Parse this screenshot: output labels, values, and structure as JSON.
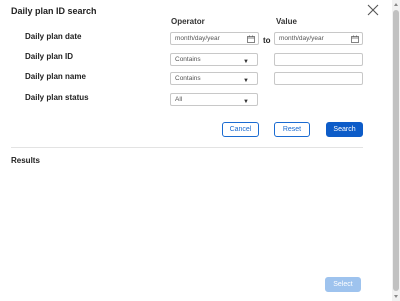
{
  "dialog": {
    "title": "Daily plan ID search",
    "close_icon": "close-icon"
  },
  "columns": {
    "operator": "Operator",
    "value": "Value"
  },
  "rows": {
    "date": {
      "label": "Daily plan date",
      "from_placeholder": "month/day/year",
      "to_label": "to",
      "to_placeholder": "month/day/year"
    },
    "id": {
      "label": "Daily plan ID",
      "operator": "Contains",
      "value": ""
    },
    "name": {
      "label": "Daily plan name",
      "operator": "Contains",
      "value": ""
    },
    "status": {
      "label": "Daily plan status",
      "operator": "All"
    }
  },
  "buttons": {
    "cancel": "Cancel",
    "reset": "Reset",
    "search": "Search",
    "select": "Select"
  },
  "results": {
    "label": "Results"
  },
  "colors": {
    "primary": "#0d5cc8",
    "primary_disabled": "#9ec3ee",
    "border": "#c8c8c8"
  }
}
